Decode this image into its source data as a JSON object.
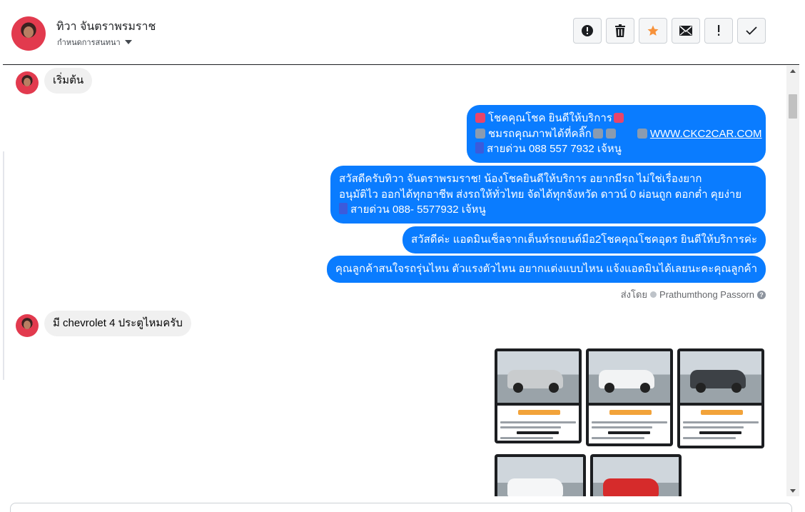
{
  "header": {
    "contact_name": "ทิวา จันตราพรมราช",
    "status_label": "กำหนดการสนทนา",
    "actions": [
      {
        "icon": "alert-circle-icon",
        "name": "mark-spam-button"
      },
      {
        "icon": "trash-icon",
        "name": "delete-button"
      },
      {
        "icon": "star-icon",
        "name": "star-button"
      },
      {
        "icon": "envelope-icon",
        "name": "mark-unread-button"
      },
      {
        "icon": "exclamation-icon",
        "name": "follow-up-button"
      },
      {
        "icon": "check-icon",
        "name": "mark-done-button"
      }
    ]
  },
  "colors": {
    "accent": "#0a7cff",
    "star": "#f7923b",
    "incoming_bubble": "#f0f0f0"
  },
  "messages": {
    "incoming_1": "เริ่มต้น",
    "out_1": {
      "line1": "โชคคุณโชค ยินดีให้บริการ",
      "line2a": "ชมรถคุณภาพได้ที่คลิ๊ก",
      "line2_link": "WWW.CKC2CAR.COM",
      "line3": "สายด่วน 088 557 7932 เจ้หนู"
    },
    "out_2": {
      "line1": "สวัสดีครับทิวา จันตราพรมราช! น้องโชคยินดีให้บริการ อยากมีรถ ไม่ใช่เรื่องยาก",
      "line2": "อนุมัติไว ออกได้ทุกอาชีพ ส่งรถให้ทั่วไทย จัดได้ทุกจังหวัด ดาวน์ 0  ผ่อนถูก ดอกต่ำ คุยง่าย",
      "line3": "สายด่วน 088- 5577932 เจ้หนู"
    },
    "out_3": "สวัสดีค่ะ แอดมินเซ็ลจากเต็นท์รถยนต์มือ2โชคคุณโชคอุดร ยินดีให้บริการค่ะ",
    "out_4": "คุณลูกค้าสนใจรถรุ่นไหน ตัวแรงตัวไหน อยากแต่งแบบไหน แจ้งแอดมินได้เลยนะคะคุณลูกค้า",
    "sent_by_prefix": "ส่งโดย",
    "sent_by_name": "Prathumthong Passorn",
    "incoming_2": "มี chevrolet 4 ประตูไหมครับ"
  },
  "car_cards": [
    {
      "color": "#c9ccce",
      "photo_label": "silver-pickup-photo"
    },
    {
      "color": "#f2f3f4",
      "photo_label": "white-pickup-photo"
    },
    {
      "color": "#3d4146",
      "photo_label": "dark-pickup-photo"
    },
    {
      "color": "#f5f6f7",
      "photo_label": "white-pickup-photo"
    },
    {
      "color": "#d62b2b",
      "photo_label": "red-pickup-photo"
    }
  ]
}
